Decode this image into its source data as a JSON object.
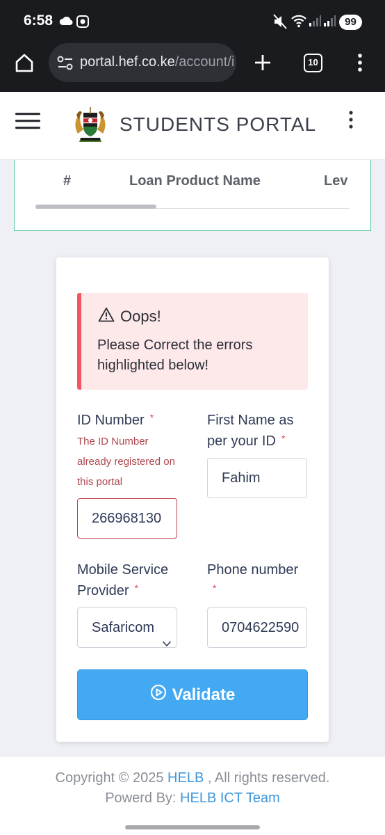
{
  "status_bar": {
    "time": "6:58",
    "battery": "99",
    "icons": [
      "cloud-icon",
      "app-notification-icon",
      "mute-icon",
      "wifi-icon",
      "signal-icon",
      "signal-icon"
    ]
  },
  "browser": {
    "url_host": "portal.hef.co.ke",
    "url_path": "/account/i",
    "tab_count": "10",
    "icons": [
      "home-icon",
      "site-settings-icon",
      "new-tab-icon",
      "menu-icon"
    ]
  },
  "header": {
    "title": "STUDENTS PORTAL",
    "icons": [
      "hamburger-menu-icon",
      "coat-of-arms-logo",
      "kebab-menu-icon"
    ]
  },
  "table": {
    "columns": [
      "#",
      "Loan Product Name",
      "Lev"
    ]
  },
  "alert": {
    "title": "Oops!",
    "message": "Please Correct the errors highlighted below!"
  },
  "form": {
    "id_number": {
      "label": "ID Number",
      "required": "*",
      "error": "The ID Number already registered on this portal",
      "value": "266968130"
    },
    "first_name": {
      "label": "First Name as per your ID",
      "required": "*",
      "value": "Fahim"
    },
    "provider": {
      "label": "Mobile Service Provider",
      "required": "*",
      "value": "Safaricom"
    },
    "phone": {
      "label": "Phone number",
      "required": "*",
      "value": "0704622590"
    },
    "validate_label": "Validate"
  },
  "footer": {
    "copyright_prefix": "Copyright © 2025",
    "copyright_link": "HELB",
    "copyright_suffix": ", All rights reserved.",
    "powered_prefix": "Powerd By:",
    "powered_link": "HELB ICT Team"
  },
  "colors": {
    "accent": "#42a9f2",
    "error": "#c1444c",
    "alert_bg": "#fde8ea",
    "link": "#3c97dc"
  }
}
